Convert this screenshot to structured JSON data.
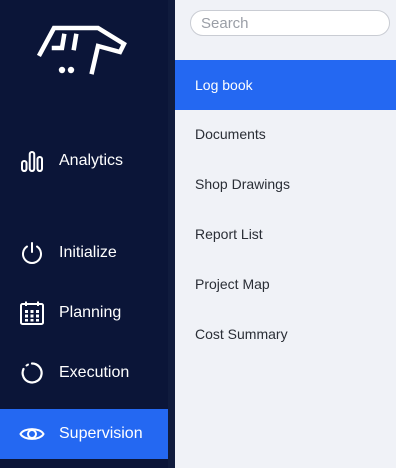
{
  "sidebar": {
    "logo_icon": "dog-head-logo",
    "items": [
      {
        "label": "Analytics",
        "icon": "bar-chart-icon",
        "active": false
      },
      {
        "label": "Initialize",
        "icon": "power-icon",
        "active": false
      },
      {
        "label": "Planning",
        "icon": "calendar-icon",
        "active": false
      },
      {
        "label": "Execution",
        "icon": "progress-ring-icon",
        "active": false
      },
      {
        "label": "Supervision",
        "icon": "eye-icon",
        "active": true
      }
    ]
  },
  "subpanel": {
    "search": {
      "placeholder": "Search",
      "value": ""
    },
    "items": [
      {
        "label": "Log book",
        "active": true
      },
      {
        "label": "Documents",
        "active": false
      },
      {
        "label": "Shop Drawings",
        "active": false
      },
      {
        "label": "Report List",
        "active": false
      },
      {
        "label": "Project Map",
        "active": false
      },
      {
        "label": "Cost Summary",
        "active": false
      }
    ]
  },
  "colors": {
    "sidebar_bg": "#0b1538",
    "accent": "#2468f2",
    "panel_bg": "#f0f2f7"
  }
}
